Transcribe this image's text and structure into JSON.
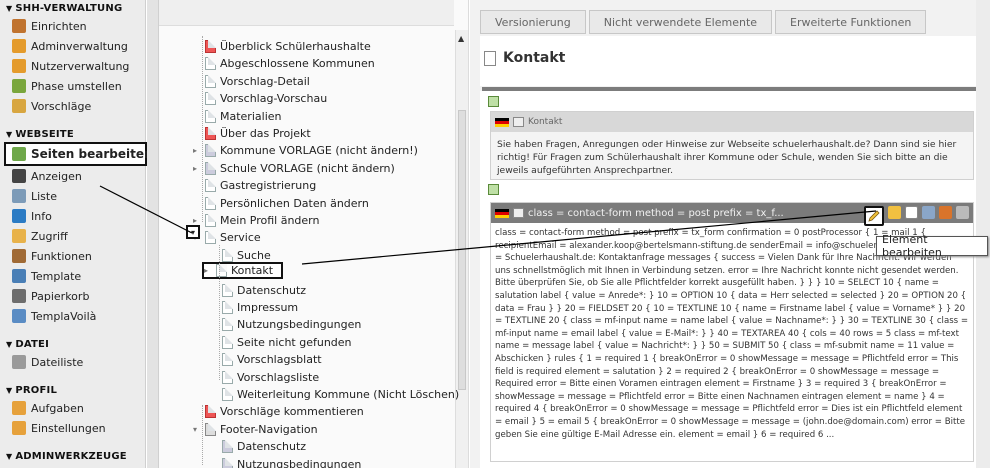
{
  "module_menu": {
    "sections": [
      {
        "title": "SHH-VERWALTUNG",
        "items": [
          {
            "label": "Einrichten",
            "icon": "gear-icon",
            "color": "#c0732f"
          },
          {
            "label": "Adminverwaltung",
            "icon": "user-admin-icon",
            "color": "#e49b2c"
          },
          {
            "label": "Nutzerverwaltung",
            "icon": "users-icon",
            "color": "#e49b2c"
          },
          {
            "label": "Phase umstellen",
            "icon": "switch-icon",
            "color": "#7aa63c"
          },
          {
            "label": "Vorschläge",
            "icon": "list-icon",
            "color": "#d8a640"
          }
        ]
      },
      {
        "title": "WEBSEITE",
        "items": [
          {
            "label": "Seiten bearbeiten",
            "icon": "page-edit-icon",
            "color": "#6fa84a",
            "active": true
          },
          {
            "label": "Anzeigen",
            "icon": "eye-icon",
            "color": "#444"
          },
          {
            "label": "Liste",
            "icon": "list-icon",
            "color": "#7d9bb8"
          },
          {
            "label": "Info",
            "icon": "info-icon",
            "color": "#2b7bc4"
          },
          {
            "label": "Zugriff",
            "icon": "lock-icon",
            "color": "#e8b24a"
          },
          {
            "label": "Funktionen",
            "icon": "wand-icon",
            "color": "#a06a35"
          },
          {
            "label": "Template",
            "icon": "template-icon",
            "color": "#4a7fb6"
          },
          {
            "label": "Papierkorb",
            "icon": "trash-icon",
            "color": "#6d6d6d"
          },
          {
            "label": "TemplaVoilà",
            "icon": "templavoila-icon",
            "color": "#5a8cc4"
          }
        ]
      },
      {
        "title": "DATEI",
        "items": [
          {
            "label": "Dateiliste",
            "icon": "folder-icon",
            "color": "#9a9a9a"
          }
        ]
      },
      {
        "title": "PROFIL",
        "items": [
          {
            "label": "Aufgaben",
            "icon": "tasks-icon",
            "color": "#e6a13b"
          },
          {
            "label": "Einstellungen",
            "icon": "settings-user-icon",
            "color": "#e6a13b"
          }
        ]
      },
      {
        "title": "ADMINWERKZEUGE",
        "items": []
      }
    ]
  },
  "tree": {
    "nodes": [
      {
        "label": "Überblick Schülerhaushalte",
        "indent": 0,
        "icon": "page-red"
      },
      {
        "label": "Abgeschlossene Kommunen",
        "indent": 0
      },
      {
        "label": "Vorschlag-Detail",
        "indent": 0
      },
      {
        "label": "Vorschlag-Vorschau",
        "indent": 0
      },
      {
        "label": "Materialien",
        "indent": 0
      },
      {
        "label": "Über das Projekt",
        "indent": 0,
        "icon": "page-red"
      },
      {
        "label": "Kommune VORLAGE (nicht ändern!)",
        "indent": 0,
        "expand": "▸",
        "icon": "page-grey"
      },
      {
        "label": "Schule VORLAGE (nicht ändern)",
        "indent": 0,
        "expand": "▸",
        "icon": "page-grey"
      },
      {
        "label": "Gastregistrierung",
        "indent": 0
      },
      {
        "label": "Persönlichen Daten ändern",
        "indent": 0
      },
      {
        "label": "Mein Profil ändern",
        "indent": 0,
        "expand": "▸"
      },
      {
        "label": "Service",
        "indent": 0,
        "expand": "▾"
      },
      {
        "label": "Suche",
        "indent": 1
      },
      {
        "label": "Kontakt",
        "indent": 1,
        "expand": "▸",
        "boxed": true
      },
      {
        "label": "Datenschutz",
        "indent": 1
      },
      {
        "label": "Impressum",
        "indent": 1
      },
      {
        "label": "Nutzungsbedingungen",
        "indent": 1
      },
      {
        "label": "Seite nicht gefunden",
        "indent": 1
      },
      {
        "label": "Vorschlagsblatt",
        "indent": 1
      },
      {
        "label": "Vorschlagsliste",
        "indent": 1
      },
      {
        "label": "Weiterleitung Kommune (Nicht Löschen)",
        "indent": 1
      },
      {
        "label": "Vorschläge kommentieren",
        "indent": 0,
        "icon": "page-red"
      },
      {
        "label": "Footer-Navigation",
        "indent": 0,
        "expand": "▾",
        "icon": "folder"
      },
      {
        "label": "Datenschutz",
        "indent": 1,
        "icon": "page-grey"
      },
      {
        "label": "Nutzungsbedingungen",
        "indent": 1,
        "icon": "page-grey"
      }
    ]
  },
  "content": {
    "tabs": [
      "Versionierung",
      "Nicht verwendete Elemente",
      "Erweiterte Funktionen"
    ],
    "page_title": "Kontakt",
    "ce1": {
      "header": "Kontakt",
      "body": "Sie haben Fragen, Anregungen oder Hinweise zur Webseite schuelerhaushalt.de? Dann sind sie hier richtig! Für Fragen zum Schülerhaushalt ihrer Kommune oder Schule, wenden Sie sich bitte an die jeweils aufgeführten Ansprechpartner."
    },
    "ce2": {
      "header": "class = contact-form method = post prefix = tx_f...",
      "body": "class = contact-form method = post prefix = tx_form confirmation = 0 postProcessor { 1 = mail 1 { recipientEmail = alexander.koop@bertelsmann-stiftung.de senderEmail = info@schuelerhaushalt.de subject = Schuelerhaushalt.de: Kontaktanfrage messages { success = Vielen Dank für Ihre Nachricht. Wir werden uns schnellstmöglich mit Ihnen in Verbindung setzen. error = Ihre Nachricht konnte nicht gesendet werden. Bitte überprüfen Sie, ob Sie alle Pflichtfelder korrekt ausgefüllt haben. } } } 10 = SELECT 10 { name = salutation label { value = Anrede*: } 10 = OPTION 10 { data = Herr selected = selected } 20 = OPTION 20 { data = Frau } } 20 = FIELDSET 20 { 10 = TEXTLINE 10 { name = Firstname label { value = Vorname* } } 20 = TEXTLINE 20 { class = mf-input name = name label { value = Nachname*: } } 30 = TEXTLINE 30 { class = mf-input name = email label { value = E-Mail*: } } 40 = TEXTAREA 40 { cols = 40 rows = 5 class = mf-text name = message label { value = Nachricht*: } } 50 = SUBMIT 50 { class = mf-submit name = 11 value = Abschicken } rules { 1 = required 1 { breakOnError = 0 showMessage = message = Pflichtfeld error = This field is required element = salutation } 2 = required 2 { breakOnError = 0 showMessage = message = Required error = Bitte einen Voramen eintragen element = Firstname } 3 = required 3 { breakOnError = showMessage = message = Pflichtfeld error = Bitte einen Nachnamen eintragen element = name } 4 = required 4 { breakOnError = 0 showMessage = message = Pflichtfeld error = Dies ist ein Pflichtfeld element = email } 5 = email 5 { breakOnError = 0 showMessage = message = (john.doe@domain.com) error = Bitte geben Sie eine gültige E-Mail Adresse ein. element = email } 6 = required 6 ..."
    },
    "tooltip": "Element bearbeiten"
  }
}
